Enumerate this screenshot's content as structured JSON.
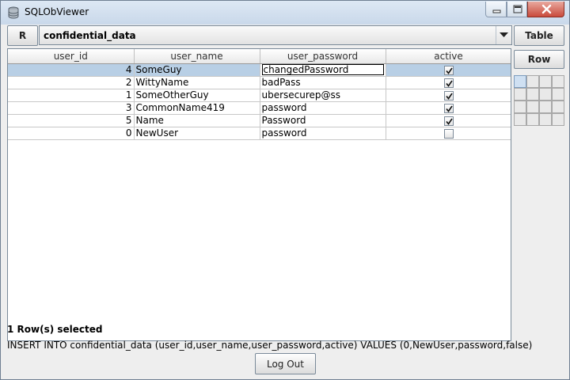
{
  "window": {
    "title": "SQLObViewer",
    "controls": {
      "minimize": "minimize",
      "maximize": "maximize",
      "close": "close"
    }
  },
  "toolbar": {
    "refresh_label": "R",
    "table_select_value": "confidential_data",
    "table_button_label": "Table",
    "row_button_label": "Row"
  },
  "table": {
    "columns": [
      "user_id",
      "user_name",
      "user_password",
      "active"
    ],
    "rows": [
      {
        "user_id": "4",
        "user_name": "SomeGuy",
        "user_password": "changedPassword",
        "active": true,
        "selected": true,
        "editing": "user_password"
      },
      {
        "user_id": "2",
        "user_name": "WittyName",
        "user_password": "badPass",
        "active": true
      },
      {
        "user_id": "1",
        "user_name": "SomeOtherGuy",
        "user_password": "ubersecurep@ss",
        "active": true
      },
      {
        "user_id": "3",
        "user_name": "CommonName419",
        "user_password": "password",
        "active": true
      },
      {
        "user_id": "5",
        "user_name": "Name",
        "user_password": "Password",
        "active": true
      },
      {
        "user_id": "0",
        "user_name": "NewUser",
        "user_password": "password",
        "active": false
      }
    ]
  },
  "status": {
    "selection_text": "1 Row(s) selected",
    "sql_text": "INSERT INTO confidential_data (user_id,user_name,user_password,active) VALUES (0,NewUser,password,false)"
  },
  "footer": {
    "logout_label": "Log Out"
  },
  "colors": {
    "selection": "#b8cfe5",
    "titlebar": "#c9d8ea",
    "close_button": "#c94b3c"
  }
}
